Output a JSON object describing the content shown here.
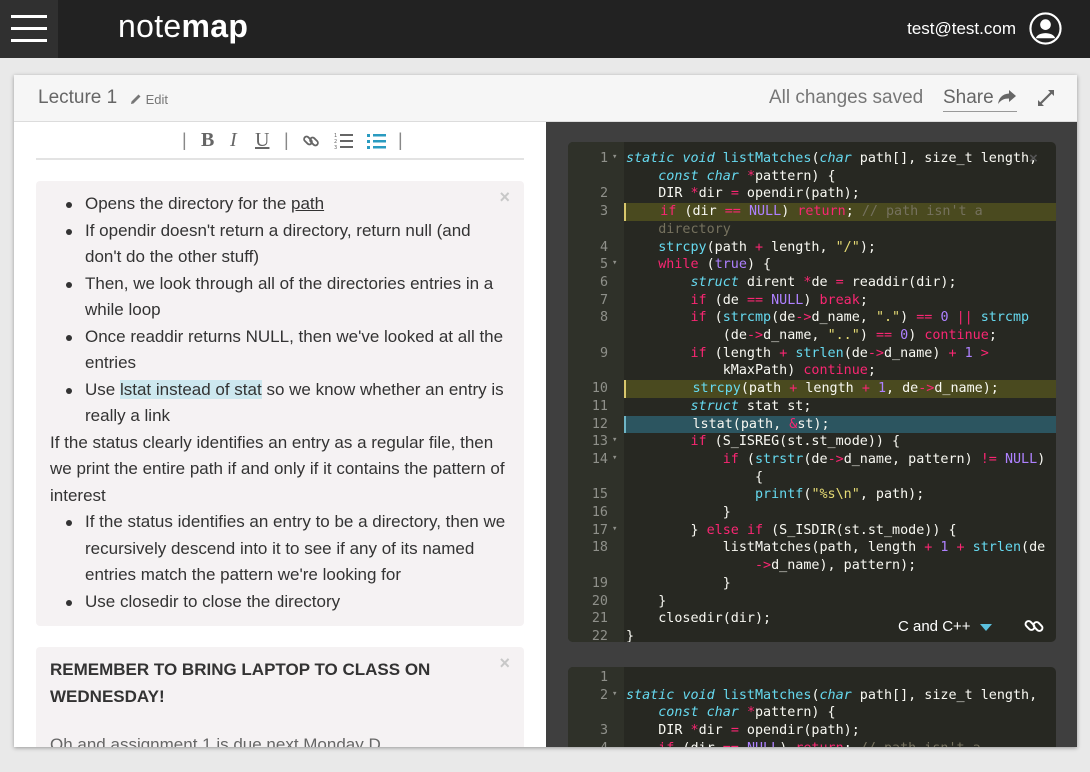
{
  "app": {
    "logo_part1": "note",
    "logo_part2": "map",
    "user_email": "test@test.com",
    "menu_icon": "hamburger-icon",
    "user_icon": "user-circle-icon"
  },
  "header": {
    "title": "Lecture 1",
    "edit_label": "Edit",
    "status": "All changes saved",
    "share_label": "Share",
    "share_icon": "share-arrow-icon",
    "expand_icon": "expand-icon"
  },
  "toolbar": {
    "bold": "B",
    "italic": "I",
    "underline": "U",
    "separator": "|",
    "link_icon": "link-icon",
    "ordered_list_icon": "ordered-list-icon",
    "bullet_list_icon": "bullet-list-icon",
    "active_color": "#2a9bc0"
  },
  "note1": {
    "close": "×",
    "b1_pre": "Opens the directory for the ",
    "b1_link": "path",
    "b2": "If opendir doesn't return a directory, return null (and don't do the other stuff)",
    "b3": "Then, we look through all of the directories entries in a while loop",
    "b4": "Once readdir returns NULL, then we've looked at all the entries",
    "b5_pre": "Use ",
    "b5_hl": "lstat instead of stat",
    "b5_post": " so we know whether an entry is really a link",
    "p1": "If the status clearly identifies an entry as a regular file, then we print the entire path if and only if it contains the pattern of interest",
    "b6": "If the status identifies an entry to be a directory, then we recursively descend into it to see if any of its named entries match the pattern we're looking for",
    "b7": "Use closedir to close the directory"
  },
  "note2": {
    "close": "×",
    "text": "REMEMBER TO BRING LAPTOP TO CLASS ON WEDNESDAY!",
    "fade_text": "Oh and assignment 1 is due next Monday D..."
  },
  "editor1": {
    "close": "×",
    "language": "C and C++",
    "link_icon": "link-icon",
    "gutter": [
      "1",
      "",
      "2",
      "3",
      "",
      "4",
      "5",
      "6",
      "7",
      "8",
      "",
      "9",
      "",
      "10",
      "11",
      "12",
      "13",
      "14",
      "",
      "15",
      "16",
      "17",
      "18",
      "",
      "19",
      "20",
      "21",
      "22"
    ]
  },
  "editor2": {
    "gutter": [
      "1",
      "2",
      "",
      "3",
      "4"
    ]
  },
  "colors": {
    "topbar": "#222222",
    "editor_bg": "#272822",
    "highlight_yellow": "#4a4a1f",
    "highlight_blue": "#2c5560",
    "accent": "#5bc0de"
  }
}
